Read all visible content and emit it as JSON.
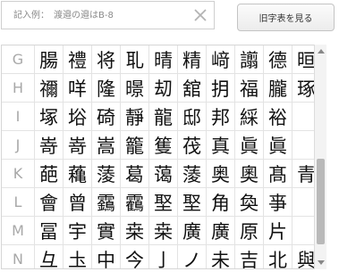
{
  "search": {
    "placeholder": "記入例：　渡邉の邉はB-8",
    "value": ""
  },
  "clear_icon": "close-icon",
  "old_chars_button": {
    "label": "旧字表を見る"
  },
  "grid": {
    "rows": [
      {
        "letter": "G",
        "chars": [
          "腸",
          "禮",
          "将",
          "耴",
          "晴",
          "精",
          "﨑",
          "譾",
          "德",
          "晅"
        ]
      },
      {
        "letter": "H",
        "chars": [
          "禰",
          "咩",
          "隆",
          "暻",
          "刧",
          "舘",
          "抈",
          "福",
          "朧",
          "琢"
        ]
      },
      {
        "letter": "I",
        "chars": [
          "塚",
          "﨏",
          "碕",
          "靜",
          "龍",
          "邸",
          "邦",
          "綵",
          "裕",
          ""
        ]
      },
      {
        "letter": "J",
        "chars": [
          "嵜",
          "嵜",
          "嵩",
          "籠",
          "篗",
          "茷",
          "真",
          "眞",
          "眞",
          ""
        ]
      },
      {
        "letter": "K",
        "chars": [
          "葩",
          "蘒",
          "蔆",
          "葛",
          "蔼",
          "蔆",
          "奥",
          "奧",
          "髙",
          "青"
        ]
      },
      {
        "letter": "L",
        "chars": [
          "會",
          "曾",
          "靎",
          "靏",
          "埾",
          "埾",
          "角",
          "奐",
          "亊",
          ""
        ]
      },
      {
        "letter": "M",
        "chars": [
          "冨",
          "宇",
          "實",
          "桒",
          "桒",
          "廣",
          "廣",
          "原",
          "片",
          ""
        ]
      },
      {
        "letter": "N",
        "chars": [
          "彑",
          "圡",
          "中",
          "今",
          "亅",
          "ノ",
          "未",
          "吉",
          "北",
          "與"
        ]
      }
    ]
  }
}
